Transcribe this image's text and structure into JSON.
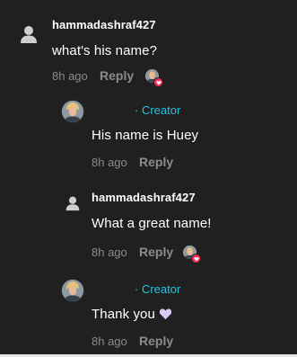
{
  "comments": [
    {
      "username": "hammadashraf427",
      "text": "what's his name?",
      "time": "8h ago",
      "reply_label": "Reply",
      "liked_by_creator": true,
      "avatar": "default-user-icon"
    },
    {
      "username": "",
      "creator_label": "· Creator",
      "text": "His name is Huey",
      "time": "8h ago",
      "reply_label": "Reply",
      "liked_by_creator": false,
      "avatar": "creator-avatar"
    },
    {
      "username": "hammadashraf427",
      "text": "What a great name!",
      "time": "8h ago",
      "reply_label": "Reply",
      "liked_by_creator": true,
      "avatar": "default-user-icon"
    },
    {
      "username": "",
      "creator_label": "· Creator",
      "text": "Thank you",
      "emoji": "white-heart",
      "time": "8h ago",
      "reply_label": "Reply",
      "liked_by_creator": false,
      "avatar": "creator-avatar"
    }
  ],
  "colors": {
    "background": "#202020",
    "text_primary": "#ffffff",
    "text_secondary": "#8b8b8b",
    "creator_accent": "#27c4e0",
    "like_badge": "#ff2d55",
    "emoji_heart": "#d9cdf7"
  }
}
